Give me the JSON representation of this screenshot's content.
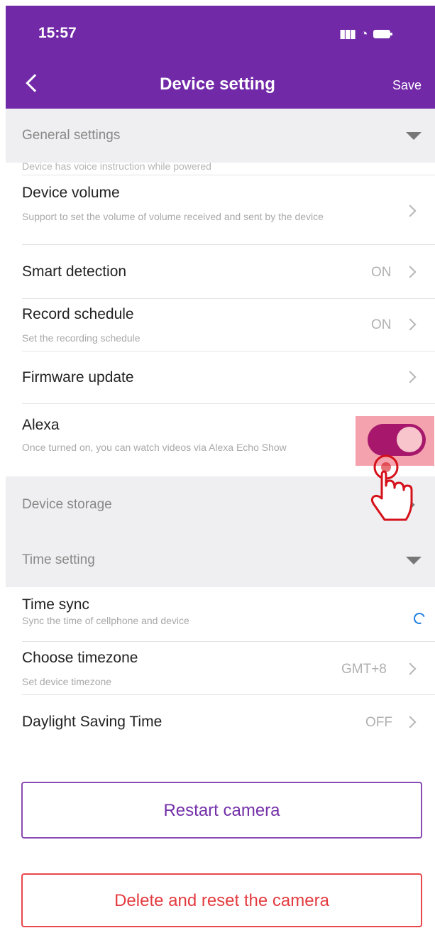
{
  "status_bar": {
    "time": "15:57",
    "signal": "⠿",
    "wifi": "◠"
  },
  "header": {
    "title": "Device setting",
    "save_label": "Save"
  },
  "general": {
    "header_label": "General settings",
    "cutoff_text": "Device has voice instruction while powered",
    "items": [
      {
        "title": "Device volume",
        "description": "Support to set the volume of volume received and sent by the device",
        "value": ""
      },
      {
        "title": "Smart detection",
        "description": "",
        "value": "ON"
      },
      {
        "title": "Record schedule",
        "description": "Set the recording schedule",
        "value": "ON"
      },
      {
        "title": "Firmware update",
        "description": "",
        "value": ""
      },
      {
        "title": "Alexa",
        "description": "Once turned on, you can watch videos via Alexa Echo Show",
        "toggle_on": true
      }
    ]
  },
  "storage": {
    "header_label": "Device storage"
  },
  "time": {
    "header_label": "Time setting",
    "items": [
      {
        "title": "Time sync",
        "description": "Sync the time of cellphone and device",
        "value": ""
      },
      {
        "title": "Choose timezone",
        "description": "Set device timezone",
        "value": "GMT+8"
      },
      {
        "title": "Daylight Saving Time",
        "description": "",
        "value": "OFF"
      }
    ]
  },
  "buttons": {
    "restart": "Restart camera",
    "delete": "Delete and reset the camera"
  },
  "colors": {
    "header_bg": "#7129a8",
    "toggle_on": "#a7186c",
    "restart_border": "#8a4ab3",
    "delete_border": "#e9474b",
    "sync_icon": "#1e7fe0"
  }
}
